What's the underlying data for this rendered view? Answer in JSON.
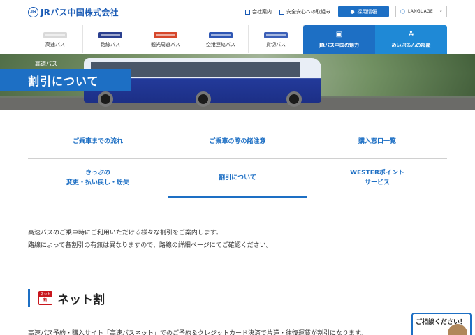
{
  "header": {
    "logo_text": "JRバス中国株式会社",
    "logo_mark": "JR",
    "company_info": "会社案内",
    "safety": "安全安心への取組み",
    "recruit": "採用情報",
    "language": "LANGUAGE"
  },
  "gnav": {
    "items": [
      {
        "label": "高速バス",
        "bus_color": "#d9d9d9"
      },
      {
        "label": "路線バス",
        "bus_color": "#2a3f8f"
      },
      {
        "label": "観光周遊バス",
        "bus_color": "#d6472b"
      },
      {
        "label": "空港連絡バス",
        "bus_color": "#2e56b4"
      },
      {
        "label": "貸切バス",
        "bus_color": "#3b5fb7"
      }
    ],
    "feature1": "JRバス中国の魅力",
    "feature2": "めいぷるんの部屋"
  },
  "hero": {
    "category": "高速バス",
    "title": "割引について"
  },
  "subnav": {
    "row1": [
      "ご乗車までの流れ",
      "ご乗車の際の諸注意",
      "購入窓口一覧"
    ],
    "row2": [
      "きっぷの\n変更・払い戻し・紛失",
      "割引について",
      "WESTERポイント\nサービス"
    ]
  },
  "intro": {
    "line1": "高速バスのご乗車時にご利用いただける様々な割引をご案内します。",
    "line2": "路線によって各割引の有無は異なりますので、路線の詳細ページにてご確認ください。"
  },
  "section": {
    "badge_top": "ネット",
    "badge_bottom": "割",
    "heading": "ネット割",
    "description": "高速バス予約・購入サイト「高速バスネット」でのご予約＆クレジットカード決済で片道・往復運賃が割引になります。"
  },
  "consult": "ご相談ください！",
  "colors": {
    "brand": "#1d6fc4",
    "accent_red": "#c8161d"
  }
}
